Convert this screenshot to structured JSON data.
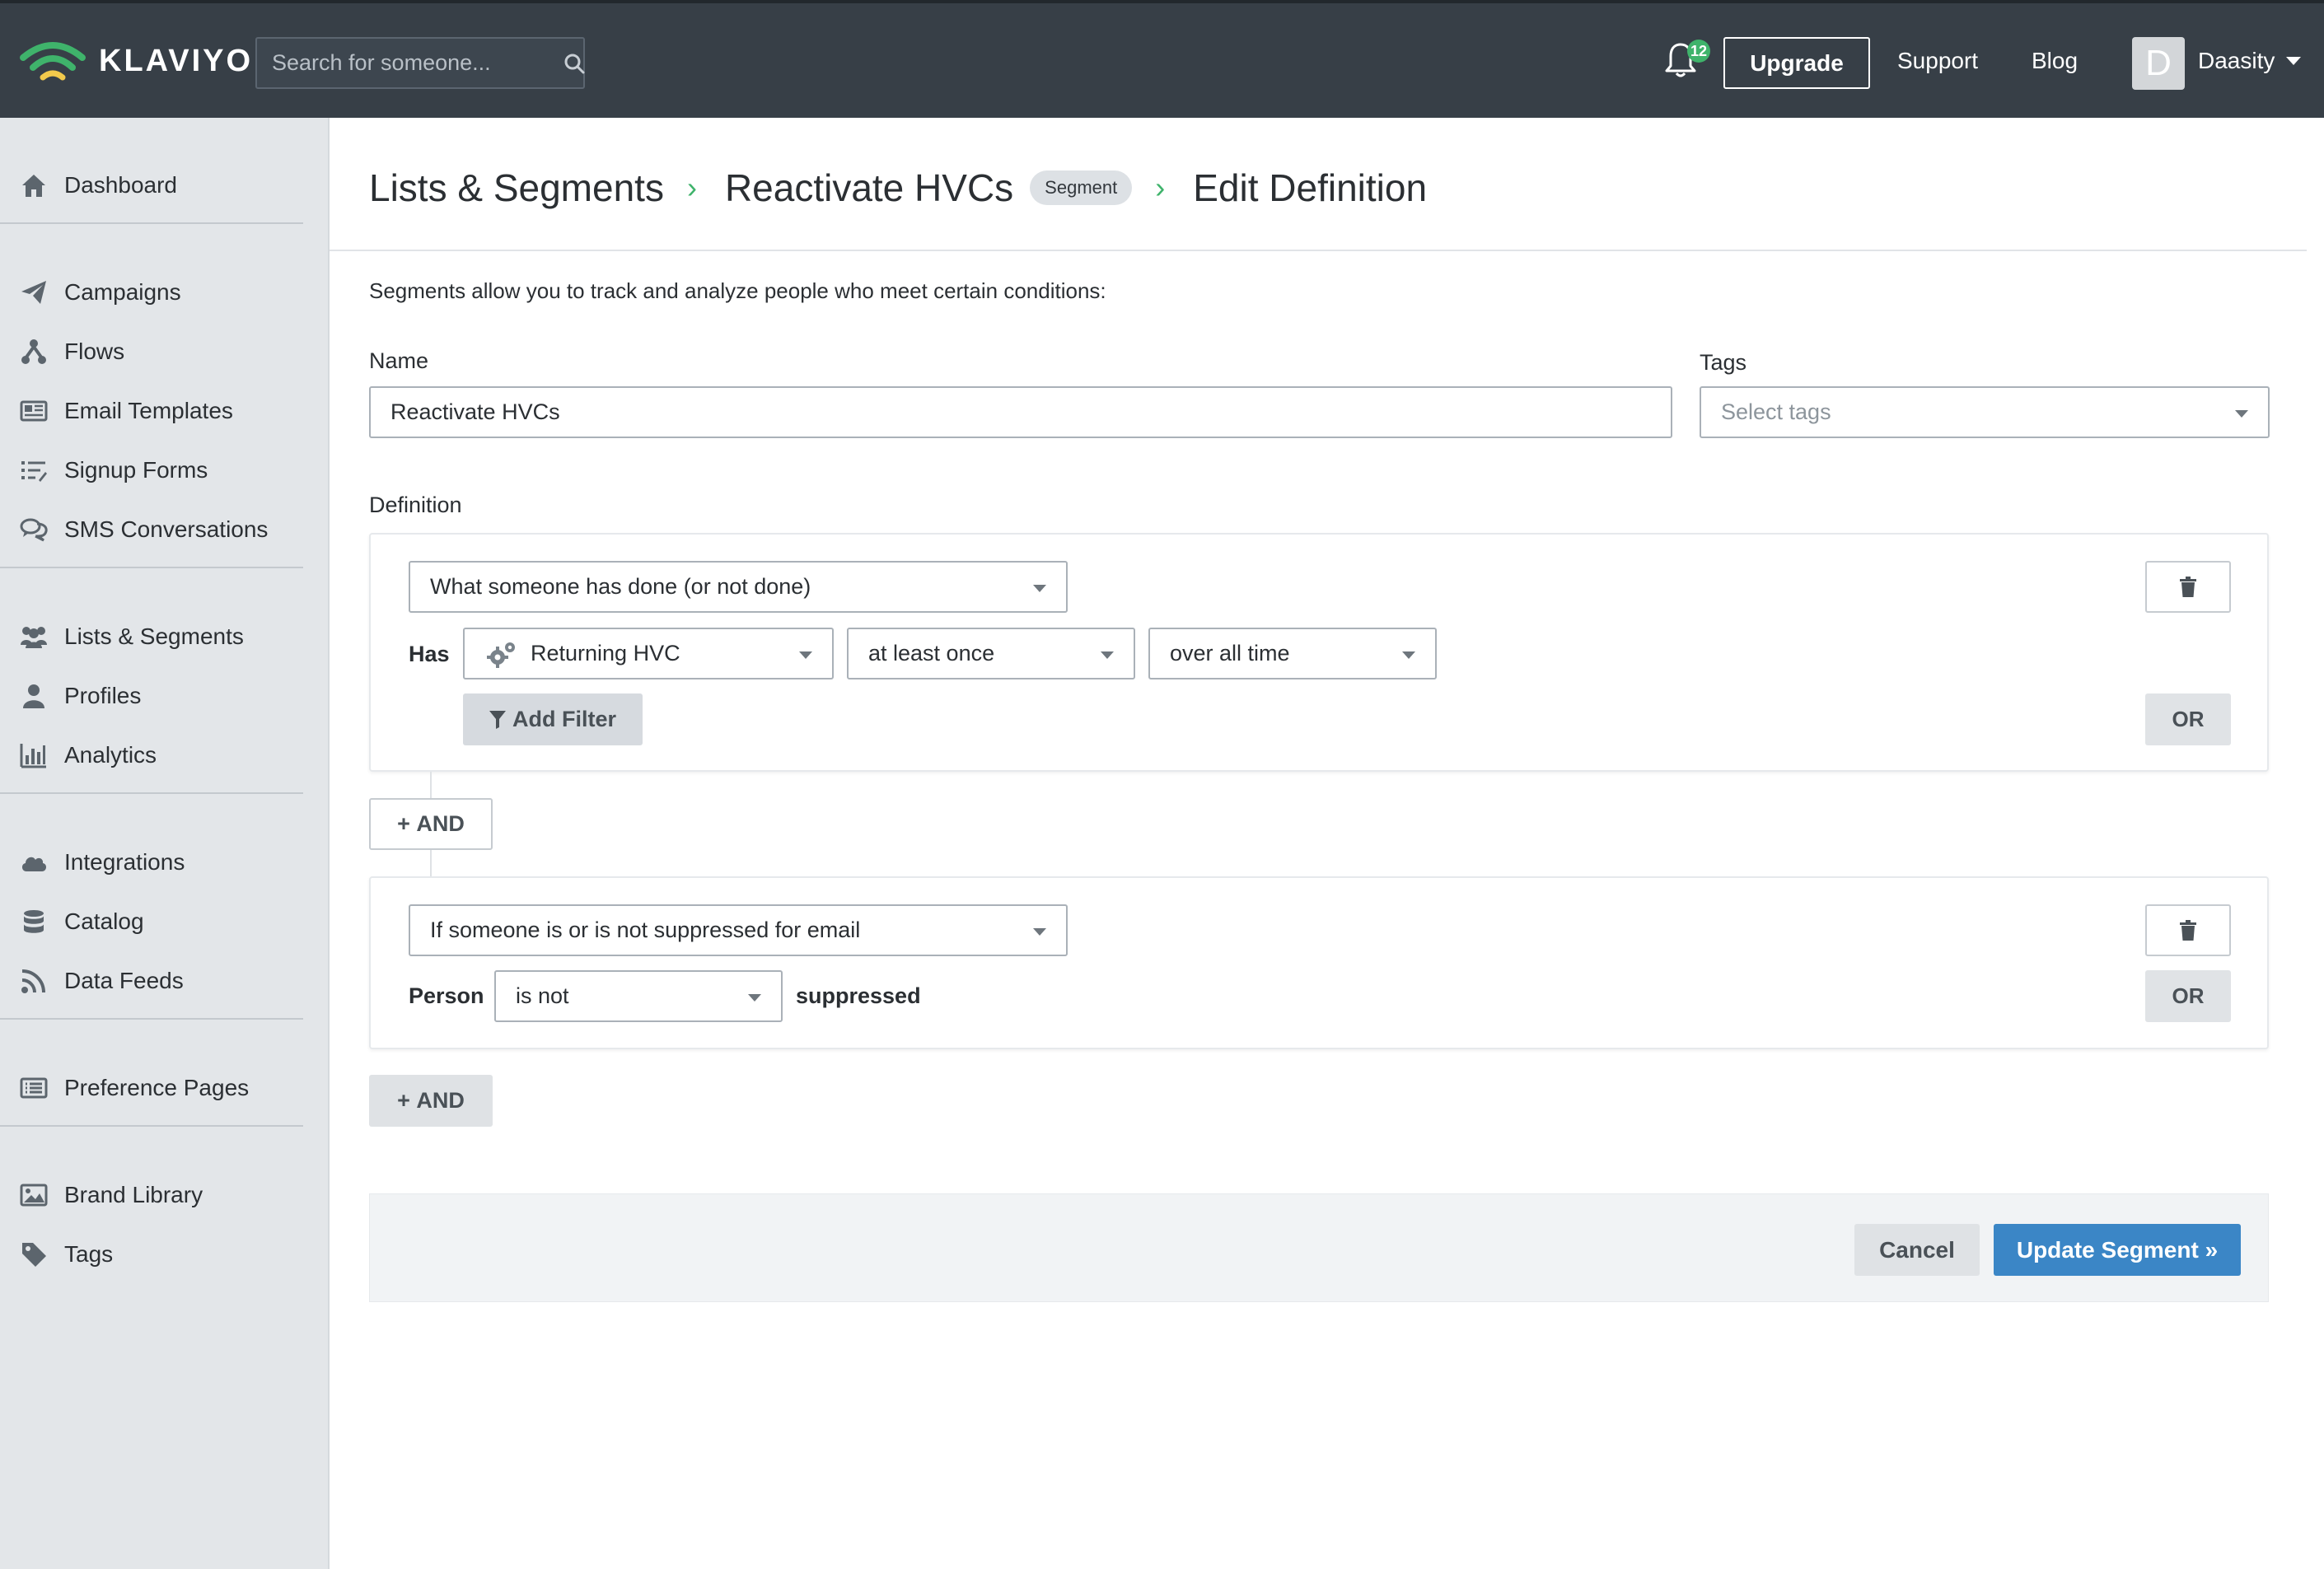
{
  "brand": {
    "name": "KLAVIYO",
    "accent": "#3fb36b",
    "link_color": "#3b86c6"
  },
  "topbar": {
    "search_placeholder": "Search for someone...",
    "notifications_count": "12",
    "upgrade_label": "Upgrade",
    "support_label": "Support",
    "blog_label": "Blog",
    "avatar_initial": "D",
    "account_name": "Daasity"
  },
  "sidebar": {
    "items": [
      {
        "label": "Dashboard",
        "icon": "home-icon"
      },
      {
        "label": "Campaigns",
        "icon": "paper-plane-icon"
      },
      {
        "label": "Flows",
        "icon": "flows-icon"
      },
      {
        "label": "Email Templates",
        "icon": "newspaper-icon"
      },
      {
        "label": "Signup Forms",
        "icon": "list-form-icon"
      },
      {
        "label": "SMS Conversations",
        "icon": "chat-bubbles-icon"
      },
      {
        "label": "Lists & Segments",
        "icon": "users-icon"
      },
      {
        "label": "Profiles",
        "icon": "user-icon"
      },
      {
        "label": "Analytics",
        "icon": "bar-chart-icon"
      },
      {
        "label": "Integrations",
        "icon": "cloud-icon"
      },
      {
        "label": "Catalog",
        "icon": "database-icon"
      },
      {
        "label": "Data Feeds",
        "icon": "rss-icon"
      },
      {
        "label": "Preference Pages",
        "icon": "list-alt-icon"
      },
      {
        "label": "Brand Library",
        "icon": "image-icon"
      },
      {
        "label": "Tags",
        "icon": "tag-icon"
      }
    ]
  },
  "breadcrumb": {
    "root": "Lists & Segments",
    "segment": "Reactivate HVCs",
    "badge": "Segment",
    "current": "Edit Definition"
  },
  "form": {
    "intro": "Segments allow you to track and analyze people who meet certain conditions:",
    "name_label": "Name",
    "name_value": "Reactivate HVCs",
    "tags_label": "Tags",
    "tags_placeholder": "Select tags",
    "definition_label": "Definition"
  },
  "conditions": [
    {
      "type_select": "What someone has done (or not done)",
      "has_label": "Has",
      "metric": "Returning HVC",
      "frequency": "at least once",
      "timeframe": "over all time",
      "add_filter_label": "Add Filter",
      "or_label": "OR"
    },
    {
      "type_select": "If someone is or is not suppressed for email",
      "person_label": "Person",
      "operator": "is not",
      "suffix": "suppressed",
      "or_label": "OR"
    }
  ],
  "and_label": "AND",
  "footer": {
    "cancel_label": "Cancel",
    "update_label": "Update Segment »"
  }
}
